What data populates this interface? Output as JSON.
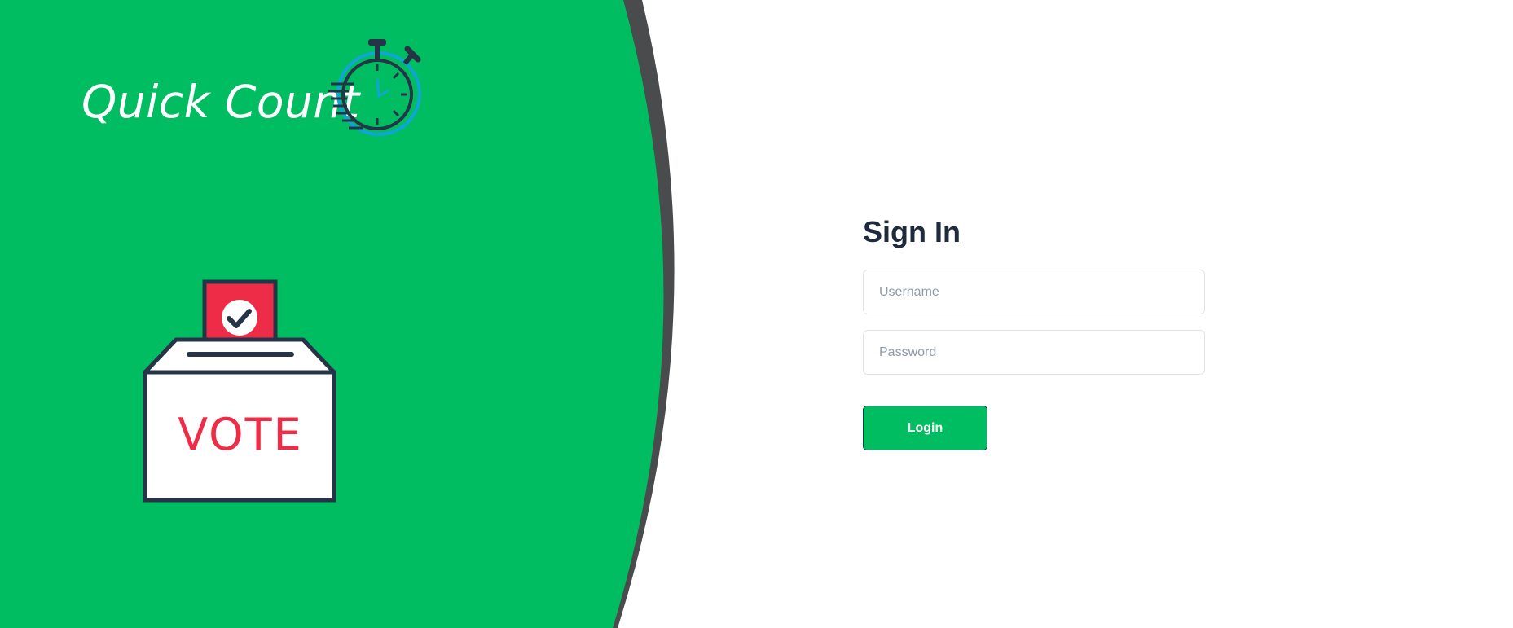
{
  "brand": {
    "name": "Quick Count",
    "logo_icon": "stopwatch-icon",
    "color_primary": "#00bd62",
    "color_shadow": "#4a4b4d"
  },
  "illustration": {
    "icon": "ballot-box-icon",
    "ballot_icon": "checkmark-icon",
    "label": "VOTE",
    "label_color": "#ee2c48"
  },
  "signin": {
    "title": "Sign In",
    "username_placeholder": "Username",
    "username_value": "",
    "password_placeholder": "Password",
    "password_value": "",
    "login_label": "Login",
    "login_color": "#00bd62",
    "title_color": "#1f2a3c"
  }
}
